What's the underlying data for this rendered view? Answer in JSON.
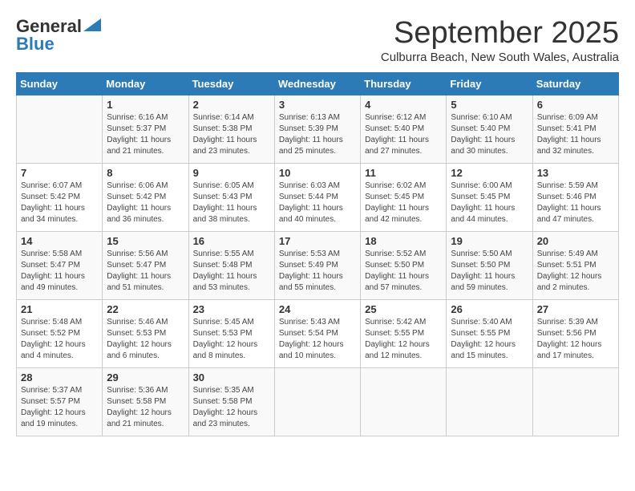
{
  "header": {
    "logo_line1": "General",
    "logo_line2": "Blue",
    "month": "September 2025",
    "location": "Culburra Beach, New South Wales, Australia"
  },
  "days_of_week": [
    "Sunday",
    "Monday",
    "Tuesday",
    "Wednesday",
    "Thursday",
    "Friday",
    "Saturday"
  ],
  "weeks": [
    [
      {
        "day": "",
        "sunrise": "",
        "sunset": "",
        "daylight": ""
      },
      {
        "day": "1",
        "sunrise": "6:16 AM",
        "sunset": "5:37 PM",
        "daylight": "11 hours and 21 minutes."
      },
      {
        "day": "2",
        "sunrise": "6:14 AM",
        "sunset": "5:38 PM",
        "daylight": "11 hours and 23 minutes."
      },
      {
        "day": "3",
        "sunrise": "6:13 AM",
        "sunset": "5:39 PM",
        "daylight": "11 hours and 25 minutes."
      },
      {
        "day": "4",
        "sunrise": "6:12 AM",
        "sunset": "5:40 PM",
        "daylight": "11 hours and 27 minutes."
      },
      {
        "day": "5",
        "sunrise": "6:10 AM",
        "sunset": "5:40 PM",
        "daylight": "11 hours and 30 minutes."
      },
      {
        "day": "6",
        "sunrise": "6:09 AM",
        "sunset": "5:41 PM",
        "daylight": "11 hours and 32 minutes."
      }
    ],
    [
      {
        "day": "7",
        "sunrise": "6:07 AM",
        "sunset": "5:42 PM",
        "daylight": "11 hours and 34 minutes."
      },
      {
        "day": "8",
        "sunrise": "6:06 AM",
        "sunset": "5:42 PM",
        "daylight": "11 hours and 36 minutes."
      },
      {
        "day": "9",
        "sunrise": "6:05 AM",
        "sunset": "5:43 PM",
        "daylight": "11 hours and 38 minutes."
      },
      {
        "day": "10",
        "sunrise": "6:03 AM",
        "sunset": "5:44 PM",
        "daylight": "11 hours and 40 minutes."
      },
      {
        "day": "11",
        "sunrise": "6:02 AM",
        "sunset": "5:45 PM",
        "daylight": "11 hours and 42 minutes."
      },
      {
        "day": "12",
        "sunrise": "6:00 AM",
        "sunset": "5:45 PM",
        "daylight": "11 hours and 44 minutes."
      },
      {
        "day": "13",
        "sunrise": "5:59 AM",
        "sunset": "5:46 PM",
        "daylight": "11 hours and 47 minutes."
      }
    ],
    [
      {
        "day": "14",
        "sunrise": "5:58 AM",
        "sunset": "5:47 PM",
        "daylight": "11 hours and 49 minutes."
      },
      {
        "day": "15",
        "sunrise": "5:56 AM",
        "sunset": "5:47 PM",
        "daylight": "11 hours and 51 minutes."
      },
      {
        "day": "16",
        "sunrise": "5:55 AM",
        "sunset": "5:48 PM",
        "daylight": "11 hours and 53 minutes."
      },
      {
        "day": "17",
        "sunrise": "5:53 AM",
        "sunset": "5:49 PM",
        "daylight": "11 hours and 55 minutes."
      },
      {
        "day": "18",
        "sunrise": "5:52 AM",
        "sunset": "5:50 PM",
        "daylight": "11 hours and 57 minutes."
      },
      {
        "day": "19",
        "sunrise": "5:50 AM",
        "sunset": "5:50 PM",
        "daylight": "11 hours and 59 minutes."
      },
      {
        "day": "20",
        "sunrise": "5:49 AM",
        "sunset": "5:51 PM",
        "daylight": "12 hours and 2 minutes."
      }
    ],
    [
      {
        "day": "21",
        "sunrise": "5:48 AM",
        "sunset": "5:52 PM",
        "daylight": "12 hours and 4 minutes."
      },
      {
        "day": "22",
        "sunrise": "5:46 AM",
        "sunset": "5:53 PM",
        "daylight": "12 hours and 6 minutes."
      },
      {
        "day": "23",
        "sunrise": "5:45 AM",
        "sunset": "5:53 PM",
        "daylight": "12 hours and 8 minutes."
      },
      {
        "day": "24",
        "sunrise": "5:43 AM",
        "sunset": "5:54 PM",
        "daylight": "12 hours and 10 minutes."
      },
      {
        "day": "25",
        "sunrise": "5:42 AM",
        "sunset": "5:55 PM",
        "daylight": "12 hours and 12 minutes."
      },
      {
        "day": "26",
        "sunrise": "5:40 AM",
        "sunset": "5:55 PM",
        "daylight": "12 hours and 15 minutes."
      },
      {
        "day": "27",
        "sunrise": "5:39 AM",
        "sunset": "5:56 PM",
        "daylight": "12 hours and 17 minutes."
      }
    ],
    [
      {
        "day": "28",
        "sunrise": "5:37 AM",
        "sunset": "5:57 PM",
        "daylight": "12 hours and 19 minutes."
      },
      {
        "day": "29",
        "sunrise": "5:36 AM",
        "sunset": "5:58 PM",
        "daylight": "12 hours and 21 minutes."
      },
      {
        "day": "30",
        "sunrise": "5:35 AM",
        "sunset": "5:58 PM",
        "daylight": "12 hours and 23 minutes."
      },
      {
        "day": "",
        "sunrise": "",
        "sunset": "",
        "daylight": ""
      },
      {
        "day": "",
        "sunrise": "",
        "sunset": "",
        "daylight": ""
      },
      {
        "day": "",
        "sunrise": "",
        "sunset": "",
        "daylight": ""
      },
      {
        "day": "",
        "sunrise": "",
        "sunset": "",
        "daylight": ""
      }
    ]
  ]
}
